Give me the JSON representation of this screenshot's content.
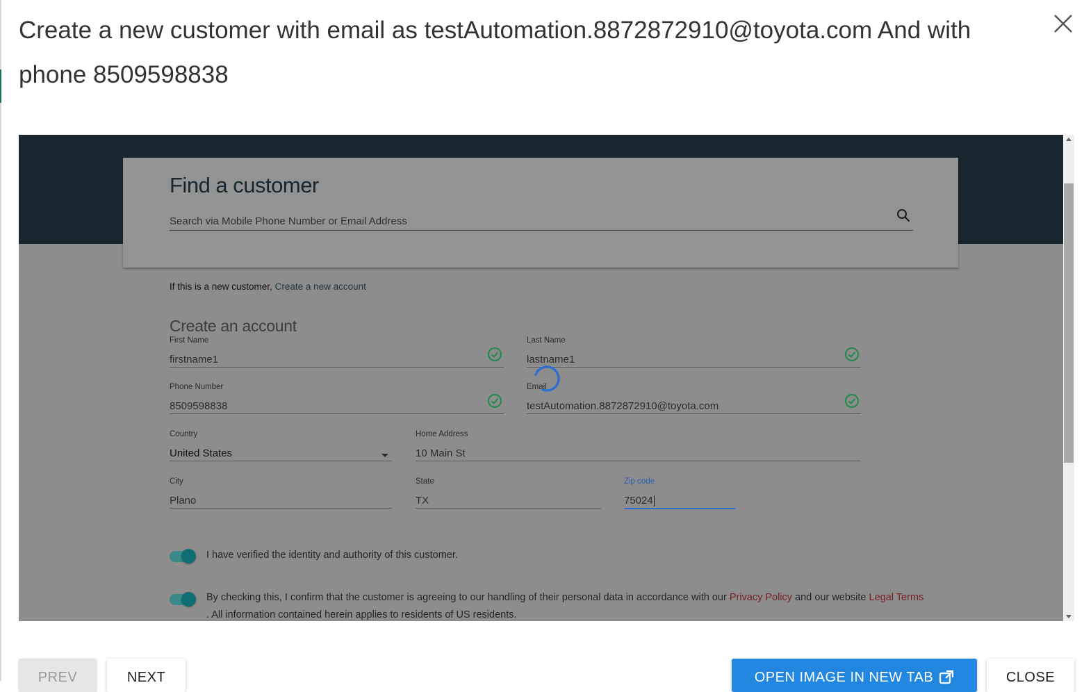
{
  "dialog": {
    "title": "Create a new customer with email as testAutomation.8872872910@toyota.com And with phone 8509598838"
  },
  "screenshot": {
    "find_customer": {
      "title": "Find a customer",
      "search_placeholder": "Search via Mobile Phone Number or Email Address"
    },
    "new_customer_prompt": "If this is a new customer,",
    "new_account_link": "Create a new account",
    "section_title": "Create an account",
    "fields": {
      "first_name": {
        "label": "First Name",
        "value": "firstname1"
      },
      "last_name": {
        "label": "Last Name",
        "value": "lastname1"
      },
      "phone": {
        "label": "Phone Number",
        "value": "8509598838"
      },
      "email": {
        "label": "Email",
        "value": "testAutomation.8872872910@toyota.com"
      },
      "country": {
        "label": "Country",
        "value": "United States"
      },
      "home_address": {
        "label": "Home Address",
        "value": "10 Main St"
      },
      "city": {
        "label": "City",
        "value": "Plano"
      },
      "state": {
        "label": "State",
        "value": "TX"
      },
      "zip": {
        "label": "Zip code",
        "value": "75024"
      }
    },
    "consent": {
      "identity": "I have verified the identity and authority of this customer.",
      "privacy_prefix": "By checking this, I confirm that the customer is agreeing to our handling of their personal data in accordance with our",
      "privacy_link": "Privacy Policy",
      "privacy_mid": "and our",
      "website_word": "website",
      "legal_link": "Legal Terms",
      "privacy_suffix": ". All information contained herein applies to residents of US residents."
    }
  },
  "footer": {
    "prev_label": "PREV",
    "next_label": "NEXT",
    "open_image_label": "OPEN IMAGE IN NEW TAB",
    "close_label": "CLOSE"
  },
  "colors": {
    "primary_button": "#2287e0",
    "header_band": "#17262f",
    "valid_check": "#1f8a4a",
    "link_red": "#7a1f1f",
    "toggle_on": "#0e6e72",
    "focus_underline": "#2f6fd0"
  },
  "icons": {
    "close": "close-x-icon",
    "search": "magnifier-icon",
    "check": "check-circle-icon",
    "dropdown": "caret-down-icon",
    "spinner": "loading-spinner-icon",
    "external": "external-link-icon"
  },
  "state": {
    "identity_verified": true,
    "privacy_agreed": true
  }
}
